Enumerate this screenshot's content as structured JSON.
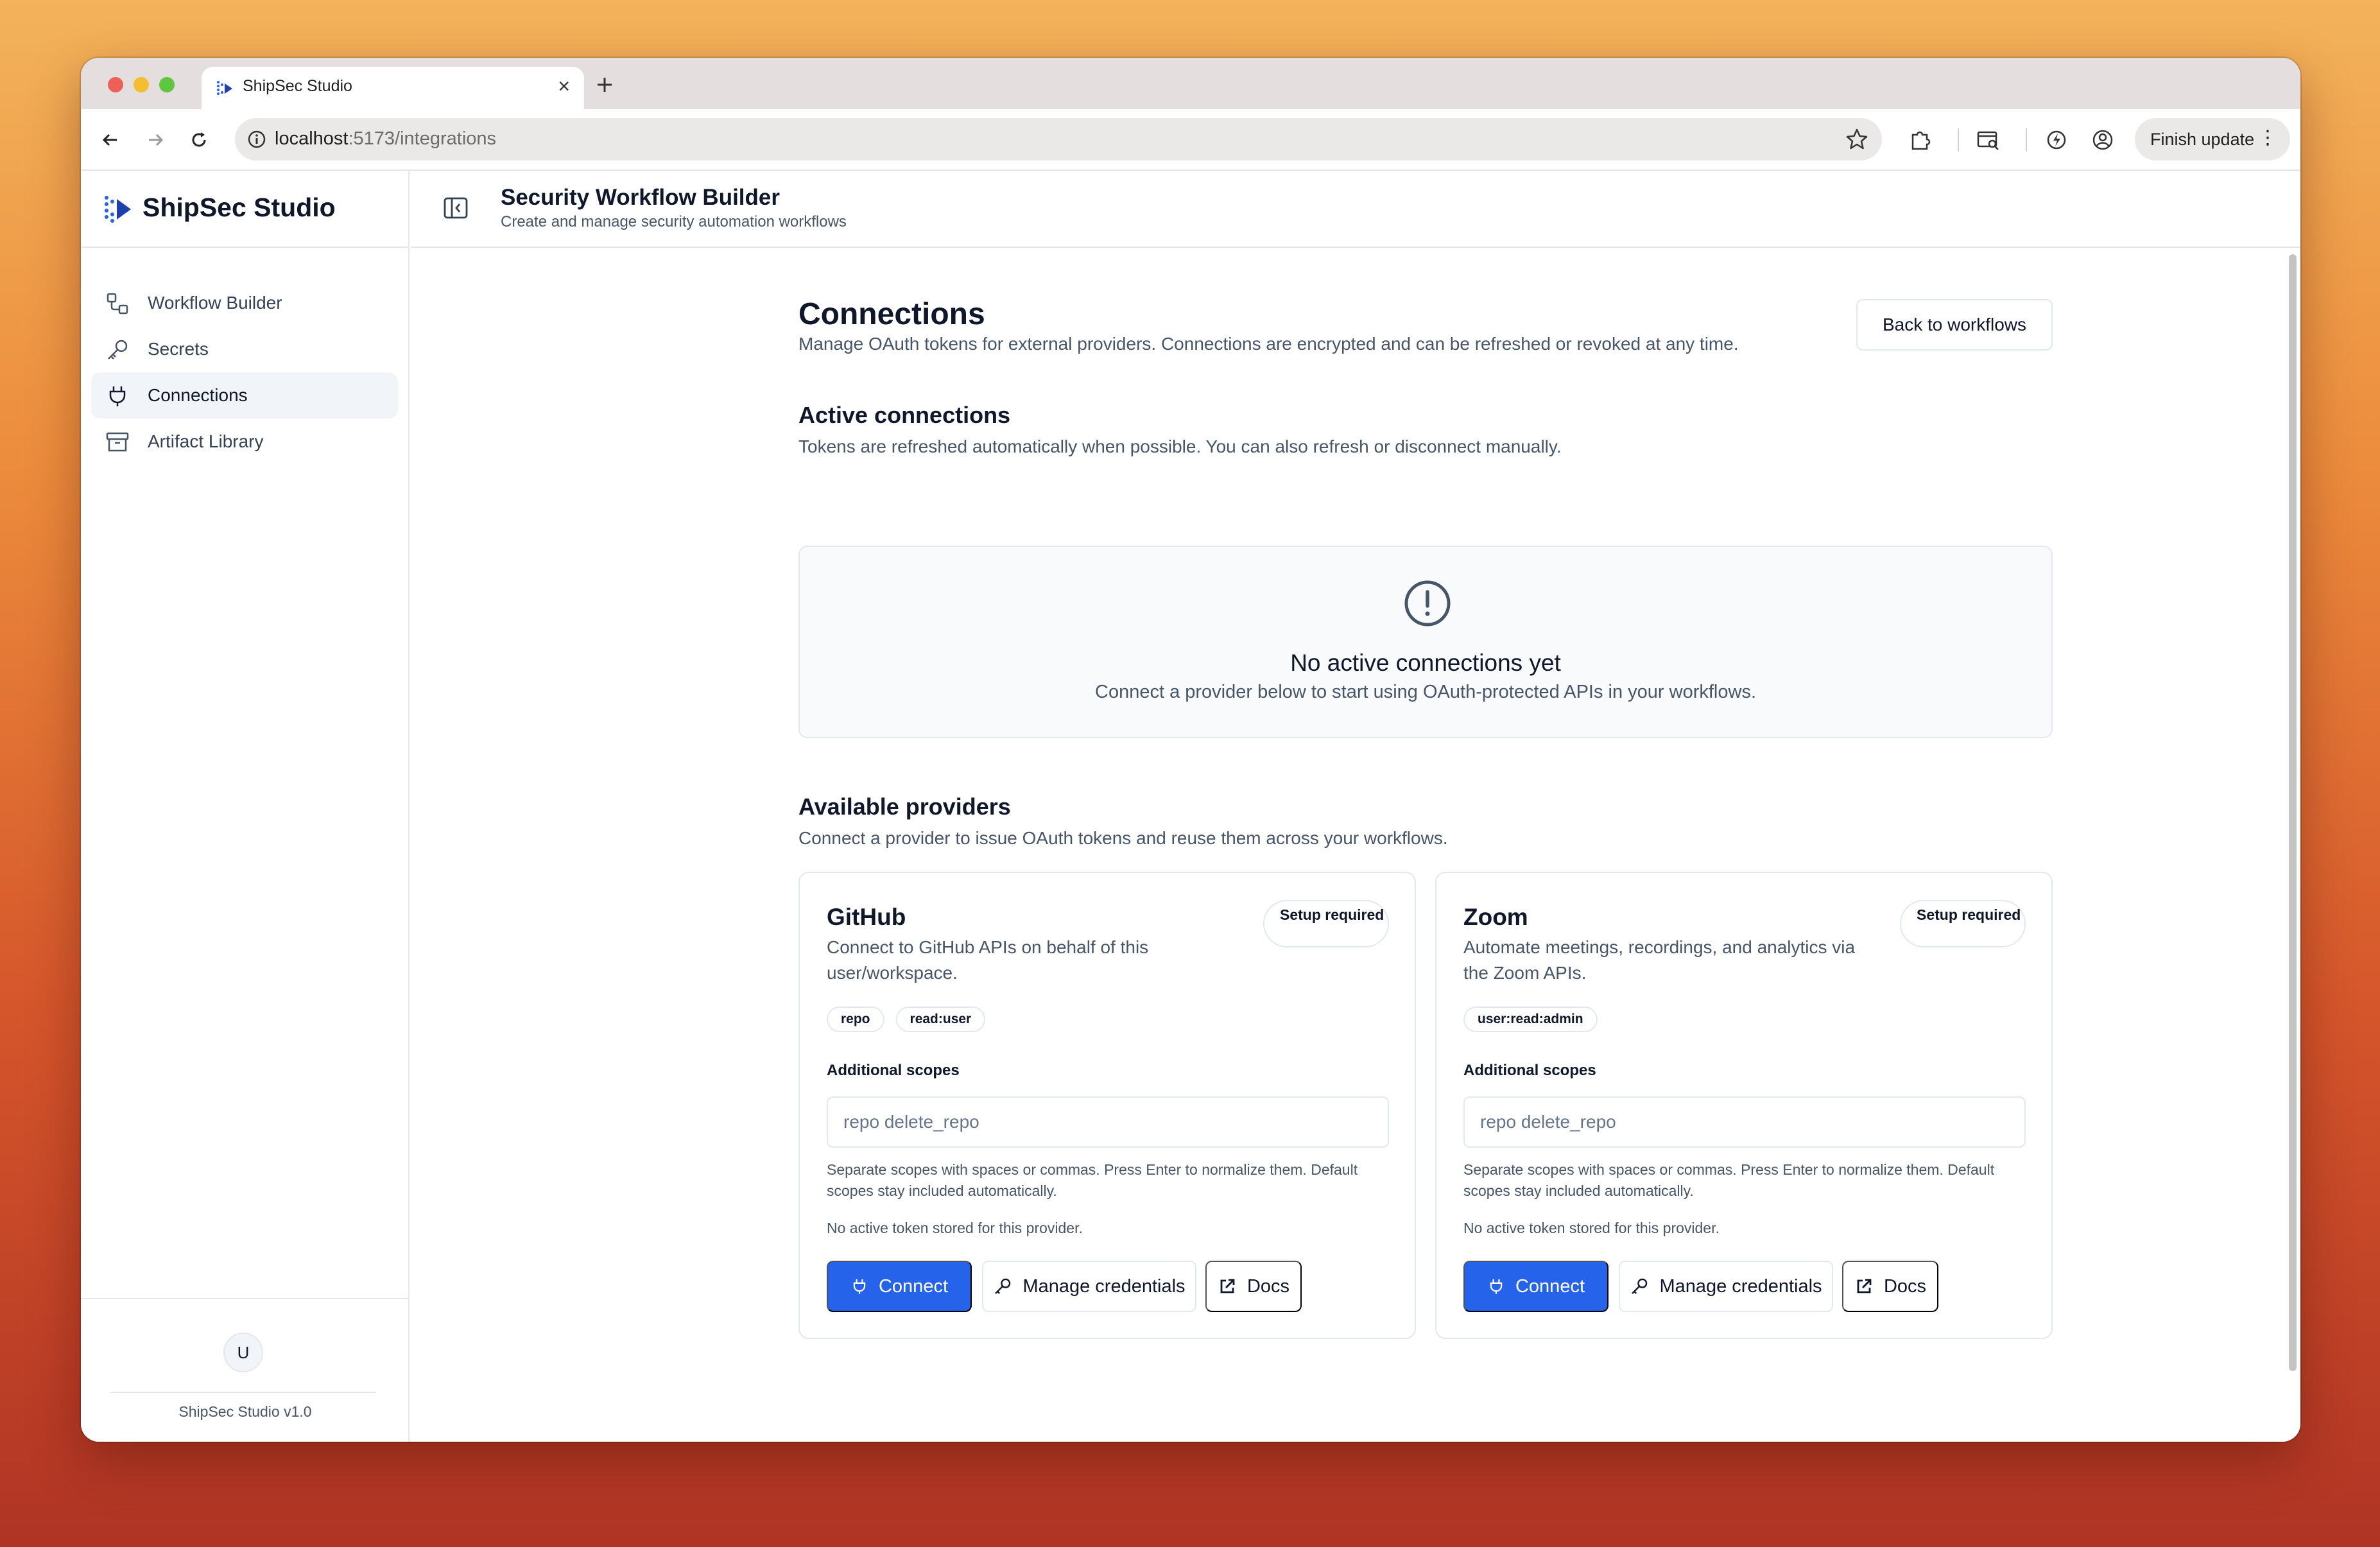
{
  "browser": {
    "tab_title": "ShipSec Studio",
    "url_host": "localhost",
    "url_path": ":5173/integrations",
    "finish_update": "Finish update"
  },
  "sidebar": {
    "brand": "ShipSec Studio",
    "items": [
      {
        "label": "Workflow Builder",
        "icon": "workflow-icon",
        "active": false
      },
      {
        "label": "Secrets",
        "icon": "key-icon",
        "active": false
      },
      {
        "label": "Connections",
        "icon": "plug-icon",
        "active": true
      },
      {
        "label": "Artifact Library",
        "icon": "archive-icon",
        "active": false
      }
    ],
    "avatar_initial": "U",
    "version": "ShipSec Studio v1.0"
  },
  "header": {
    "title": "Security Workflow Builder",
    "subtitle": "Create and manage security automation workflows"
  },
  "page": {
    "title": "Connections",
    "description": "Manage OAuth tokens for external providers. Connections are encrypted and can be refreshed or revoked at any time.",
    "back_button": "Back to workflows",
    "active": {
      "title": "Active connections",
      "description": "Tokens are refreshed automatically when possible. You can also refresh or disconnect manually.",
      "empty_title": "No active connections yet",
      "empty_description": "Connect a provider below to start using OAuth-protected APIs in your workflows."
    },
    "available": {
      "title": "Available providers",
      "description": "Connect a provider to issue OAuth tokens and reuse them across your workflows."
    }
  },
  "providers": [
    {
      "name": "GitHub",
      "description": "Connect to GitHub APIs on behalf of this user/workspace.",
      "badge": "Setup required",
      "scopes": [
        "repo",
        "read:user"
      ],
      "scopes_label": "Additional scopes",
      "scopes_placeholder": "repo delete_repo",
      "help": "Separate scopes with spaces or commas. Press Enter to normalize them. Default scopes stay included automatically.",
      "status": "No active token stored for this provider.",
      "connect": "Connect",
      "manage": "Manage credentials",
      "docs": "Docs"
    },
    {
      "name": "Zoom",
      "description": "Automate meetings, recordings, and analytics via the Zoom APIs.",
      "badge": "Setup required",
      "scopes": [
        "user:read:admin"
      ],
      "scopes_label": "Additional scopes",
      "scopes_placeholder": "repo delete_repo",
      "help": "Separate scopes with spaces or commas. Press Enter to normalize them. Default scopes stay included automatically.",
      "status": "No active token stored for this provider.",
      "connect": "Connect",
      "manage": "Manage credentials",
      "docs": "Docs"
    }
  ],
  "colors": {
    "primary": "#2563eb",
    "border": "#e2e8f0",
    "muted_text": "#475569",
    "active_nav_bg": "#f1f5f9"
  }
}
